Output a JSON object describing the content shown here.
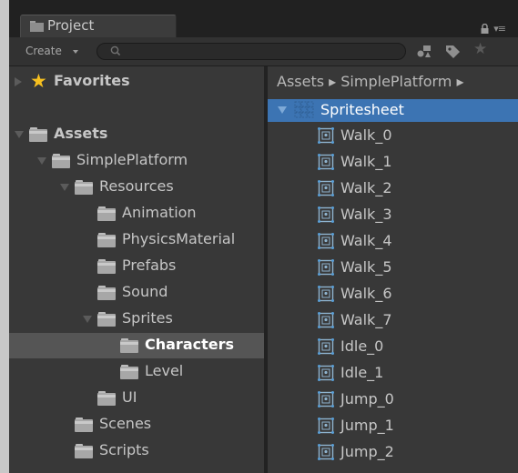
{
  "tab": {
    "title": "Project"
  },
  "toolbar": {
    "create_label": "Create",
    "search_placeholder": ""
  },
  "tree": [
    {
      "key": "favorites",
      "label": "Favorites",
      "indent": 0,
      "kind": "star",
      "arrow": "right",
      "bold": true
    },
    {
      "key": "assets",
      "label": "Assets",
      "indent": 0,
      "kind": "folder",
      "arrow": "down",
      "bold": true
    },
    {
      "key": "simpleplatform",
      "label": "SimplePlatform",
      "indent": 1,
      "kind": "folder",
      "arrow": "down"
    },
    {
      "key": "resources",
      "label": "Resources",
      "indent": 2,
      "kind": "folder",
      "arrow": "down"
    },
    {
      "key": "animation",
      "label": "Animation",
      "indent": 3,
      "kind": "folder",
      "arrow": "none"
    },
    {
      "key": "physicsmaterial",
      "label": "PhysicsMaterial",
      "indent": 3,
      "kind": "folder",
      "arrow": "none"
    },
    {
      "key": "prefabs",
      "label": "Prefabs",
      "indent": 3,
      "kind": "folder",
      "arrow": "none"
    },
    {
      "key": "sound",
      "label": "Sound",
      "indent": 3,
      "kind": "folder",
      "arrow": "none"
    },
    {
      "key": "sprites",
      "label": "Sprites",
      "indent": 3,
      "kind": "folder",
      "arrow": "down"
    },
    {
      "key": "characters",
      "label": "Characters",
      "indent": 4,
      "kind": "folder",
      "arrow": "none",
      "selected": true,
      "bold": true
    },
    {
      "key": "level",
      "label": "Level",
      "indent": 4,
      "kind": "folder",
      "arrow": "none"
    },
    {
      "key": "ui",
      "label": "UI",
      "indent": 3,
      "kind": "folder",
      "arrow": "none"
    },
    {
      "key": "scenes",
      "label": "Scenes",
      "indent": 2,
      "kind": "folder",
      "arrow": "none"
    },
    {
      "key": "scripts",
      "label": "Scripts",
      "indent": 2,
      "kind": "folder",
      "arrow": "none"
    }
  ],
  "breadcrumb": "Assets ▸ SimplePlatform ▸",
  "spritesheet": {
    "label": "Spritesheet"
  },
  "sprites": [
    "Walk_0",
    "Walk_1",
    "Walk_2",
    "Walk_3",
    "Walk_4",
    "Walk_5",
    "Walk_6",
    "Walk_7",
    "Idle_0",
    "Idle_1",
    "Jump_0",
    "Jump_1",
    "Jump_2"
  ],
  "colors": {
    "selection_blue": "#3c74b3",
    "selection_gray": "#555555",
    "panel_bg": "#383838",
    "star": "#f7c020"
  }
}
